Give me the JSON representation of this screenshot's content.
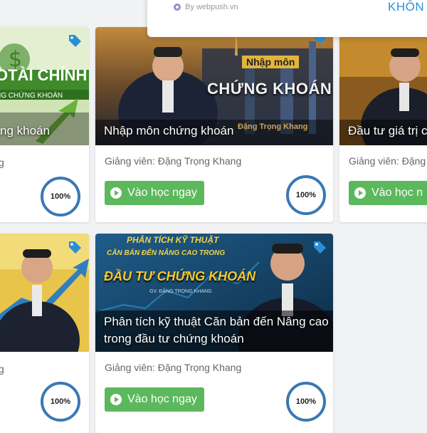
{
  "popup": {
    "brand": "By webpush.vn",
    "deny_label": "KHÔN"
  },
  "courses": [
    {
      "title": "ng khoán",
      "thumb_text": [
        "OTÀI CHÍNH",
        "NG CHỨNG KHOÁN"
      ],
      "instructor": "g",
      "progress": "100%"
    },
    {
      "title": "Nhập môn chứng khoán",
      "thumb_text": [
        "Nhập môn",
        "CHỨNG KHOÁN",
        "Đặng Trọng Khang"
      ],
      "instructor": "Giảng viên: Đặng Trọng Khang",
      "button": "Vào học ngay",
      "progress": "100%"
    },
    {
      "title": "Đầu tư giá trị c",
      "instructor": "Giảng viên: Đặng",
      "button": "Vào học n"
    },
    {
      "title": "",
      "instructor": "g",
      "progress": "100%"
    },
    {
      "title_lines": [
        "Phân tích kỹ thuật Căn bản đến Nâng cao",
        "trong đầu tư chứng khoán"
      ],
      "thumb_text": [
        "PHÂN TÍCH KỸ THUẬT",
        "CĂN BẢN ĐẾN NÂNG CAO TRONG",
        "ĐẦU TƯ CHỨNG KHOÁN",
        "GV. ĐẶNG TRỌNG KHANG"
      ],
      "instructor": "Giảng viên: Đặng Trọng Khang",
      "button": "Vào học ngay",
      "progress": "100%"
    }
  ],
  "colors": {
    "button": "#5cb85c",
    "progress_ring": "#3a78b5",
    "tag": "#2b8fd6",
    "deny": "#2b8fd6"
  }
}
